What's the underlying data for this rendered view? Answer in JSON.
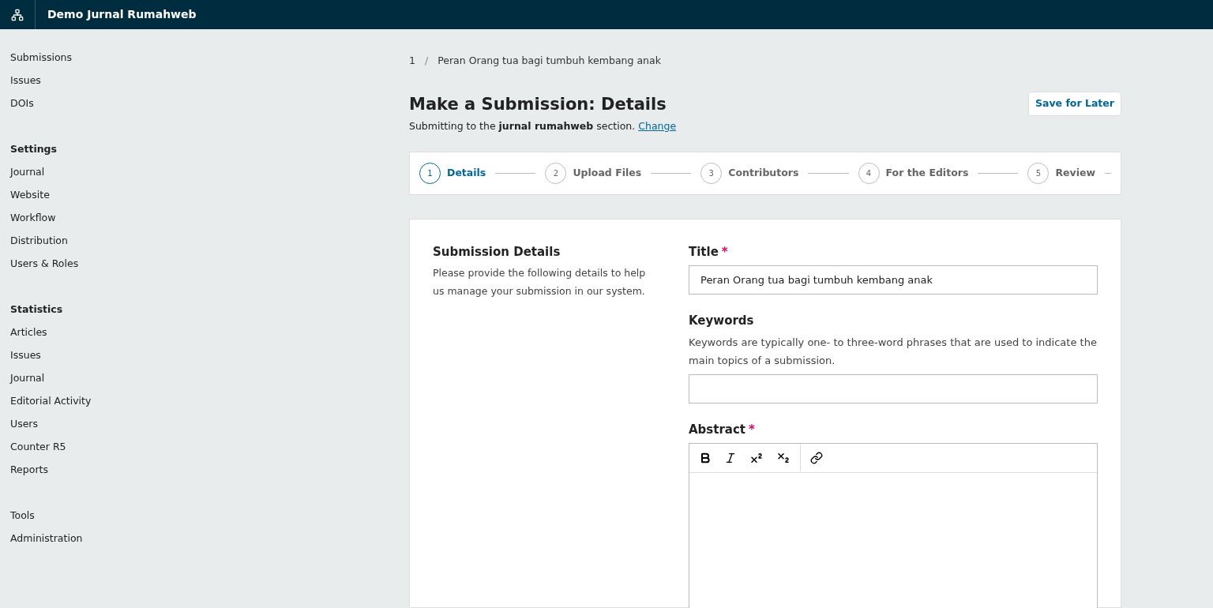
{
  "header": {
    "title": "Demo Jurnal Rumahweb"
  },
  "sidebar": [
    {
      "items": [
        "Submissions",
        "Issues",
        "DOIs"
      ]
    },
    {
      "heading": "Settings",
      "items": [
        "Journal",
        "Website",
        "Workflow",
        "Distribution",
        "Users & Roles"
      ]
    },
    {
      "heading": "Statistics",
      "items": [
        "Articles",
        "Issues",
        "Journal",
        "Editorial Activity",
        "Users",
        "Counter R5",
        "Reports"
      ]
    },
    {
      "items": [
        "Tools",
        "Administration"
      ]
    }
  ],
  "breadcrumb": [
    "1",
    "Peran Orang tua bagi tumbuh kembang anak"
  ],
  "breadcrumb_separator": "/",
  "page": {
    "title": "Make a Submission: Details",
    "subtitle": "Submitting to the **jurnal rumahweb** section.",
    "change_link": "Change",
    "save_button": "Save for Later"
  },
  "steps": [
    {
      "number": "1",
      "label": "Details",
      "selected": true
    },
    {
      "number": "2",
      "label": "Upload Files",
      "selected": false
    },
    {
      "number": "3",
      "label": "Contributors",
      "selected": false
    },
    {
      "number": "4",
      "label": "For the Editors",
      "selected": false
    },
    {
      "number": "5",
      "label": "Review",
      "selected": false
    }
  ],
  "section": {
    "title": "Submission Details",
    "description": "Please provide the following details to help us manage your submission in our system."
  },
  "fields": [
    {
      "kind": "text",
      "label": "Title",
      "required_mark": "*",
      "value": "Peran Orang tua bagi tumbuh kembang anak"
    },
    {
      "kind": "text",
      "label": "Keywords",
      "help": "Keywords are typically one- to three-word phrases that are used to indicate the main topics of a submission."
    },
    {
      "kind": "rich",
      "label": "Abstract",
      "required_mark": "*"
    }
  ]
}
